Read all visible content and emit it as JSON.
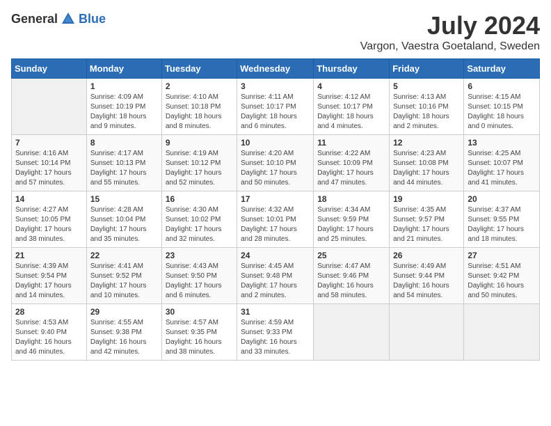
{
  "header": {
    "logo_general": "General",
    "logo_blue": "Blue",
    "month": "July 2024",
    "location": "Vargon, Vaestra Goetaland, Sweden"
  },
  "weekdays": [
    "Sunday",
    "Monday",
    "Tuesday",
    "Wednesday",
    "Thursday",
    "Friday",
    "Saturday"
  ],
  "weeks": [
    [
      {
        "day": "",
        "info": ""
      },
      {
        "day": "1",
        "info": "Sunrise: 4:09 AM\nSunset: 10:19 PM\nDaylight: 18 hours\nand 9 minutes."
      },
      {
        "day": "2",
        "info": "Sunrise: 4:10 AM\nSunset: 10:18 PM\nDaylight: 18 hours\nand 8 minutes."
      },
      {
        "day": "3",
        "info": "Sunrise: 4:11 AM\nSunset: 10:17 PM\nDaylight: 18 hours\nand 6 minutes."
      },
      {
        "day": "4",
        "info": "Sunrise: 4:12 AM\nSunset: 10:17 PM\nDaylight: 18 hours\nand 4 minutes."
      },
      {
        "day": "5",
        "info": "Sunrise: 4:13 AM\nSunset: 10:16 PM\nDaylight: 18 hours\nand 2 minutes."
      },
      {
        "day": "6",
        "info": "Sunrise: 4:15 AM\nSunset: 10:15 PM\nDaylight: 18 hours\nand 0 minutes."
      }
    ],
    [
      {
        "day": "7",
        "info": "Sunrise: 4:16 AM\nSunset: 10:14 PM\nDaylight: 17 hours\nand 57 minutes."
      },
      {
        "day": "8",
        "info": "Sunrise: 4:17 AM\nSunset: 10:13 PM\nDaylight: 17 hours\nand 55 minutes."
      },
      {
        "day": "9",
        "info": "Sunrise: 4:19 AM\nSunset: 10:12 PM\nDaylight: 17 hours\nand 52 minutes."
      },
      {
        "day": "10",
        "info": "Sunrise: 4:20 AM\nSunset: 10:10 PM\nDaylight: 17 hours\nand 50 minutes."
      },
      {
        "day": "11",
        "info": "Sunrise: 4:22 AM\nSunset: 10:09 PM\nDaylight: 17 hours\nand 47 minutes."
      },
      {
        "day": "12",
        "info": "Sunrise: 4:23 AM\nSunset: 10:08 PM\nDaylight: 17 hours\nand 44 minutes."
      },
      {
        "day": "13",
        "info": "Sunrise: 4:25 AM\nSunset: 10:07 PM\nDaylight: 17 hours\nand 41 minutes."
      }
    ],
    [
      {
        "day": "14",
        "info": "Sunrise: 4:27 AM\nSunset: 10:05 PM\nDaylight: 17 hours\nand 38 minutes."
      },
      {
        "day": "15",
        "info": "Sunrise: 4:28 AM\nSunset: 10:04 PM\nDaylight: 17 hours\nand 35 minutes."
      },
      {
        "day": "16",
        "info": "Sunrise: 4:30 AM\nSunset: 10:02 PM\nDaylight: 17 hours\nand 32 minutes."
      },
      {
        "day": "17",
        "info": "Sunrise: 4:32 AM\nSunset: 10:01 PM\nDaylight: 17 hours\nand 28 minutes."
      },
      {
        "day": "18",
        "info": "Sunrise: 4:34 AM\nSunset: 9:59 PM\nDaylight: 17 hours\nand 25 minutes."
      },
      {
        "day": "19",
        "info": "Sunrise: 4:35 AM\nSunset: 9:57 PM\nDaylight: 17 hours\nand 21 minutes."
      },
      {
        "day": "20",
        "info": "Sunrise: 4:37 AM\nSunset: 9:55 PM\nDaylight: 17 hours\nand 18 minutes."
      }
    ],
    [
      {
        "day": "21",
        "info": "Sunrise: 4:39 AM\nSunset: 9:54 PM\nDaylight: 17 hours\nand 14 minutes."
      },
      {
        "day": "22",
        "info": "Sunrise: 4:41 AM\nSunset: 9:52 PM\nDaylight: 17 hours\nand 10 minutes."
      },
      {
        "day": "23",
        "info": "Sunrise: 4:43 AM\nSunset: 9:50 PM\nDaylight: 17 hours\nand 6 minutes."
      },
      {
        "day": "24",
        "info": "Sunrise: 4:45 AM\nSunset: 9:48 PM\nDaylight: 17 hours\nand 2 minutes."
      },
      {
        "day": "25",
        "info": "Sunrise: 4:47 AM\nSunset: 9:46 PM\nDaylight: 16 hours\nand 58 minutes."
      },
      {
        "day": "26",
        "info": "Sunrise: 4:49 AM\nSunset: 9:44 PM\nDaylight: 16 hours\nand 54 minutes."
      },
      {
        "day": "27",
        "info": "Sunrise: 4:51 AM\nSunset: 9:42 PM\nDaylight: 16 hours\nand 50 minutes."
      }
    ],
    [
      {
        "day": "28",
        "info": "Sunrise: 4:53 AM\nSunset: 9:40 PM\nDaylight: 16 hours\nand 46 minutes."
      },
      {
        "day": "29",
        "info": "Sunrise: 4:55 AM\nSunset: 9:38 PM\nDaylight: 16 hours\nand 42 minutes."
      },
      {
        "day": "30",
        "info": "Sunrise: 4:57 AM\nSunset: 9:35 PM\nDaylight: 16 hours\nand 38 minutes."
      },
      {
        "day": "31",
        "info": "Sunrise: 4:59 AM\nSunset: 9:33 PM\nDaylight: 16 hours\nand 33 minutes."
      },
      {
        "day": "",
        "info": ""
      },
      {
        "day": "",
        "info": ""
      },
      {
        "day": "",
        "info": ""
      }
    ]
  ]
}
